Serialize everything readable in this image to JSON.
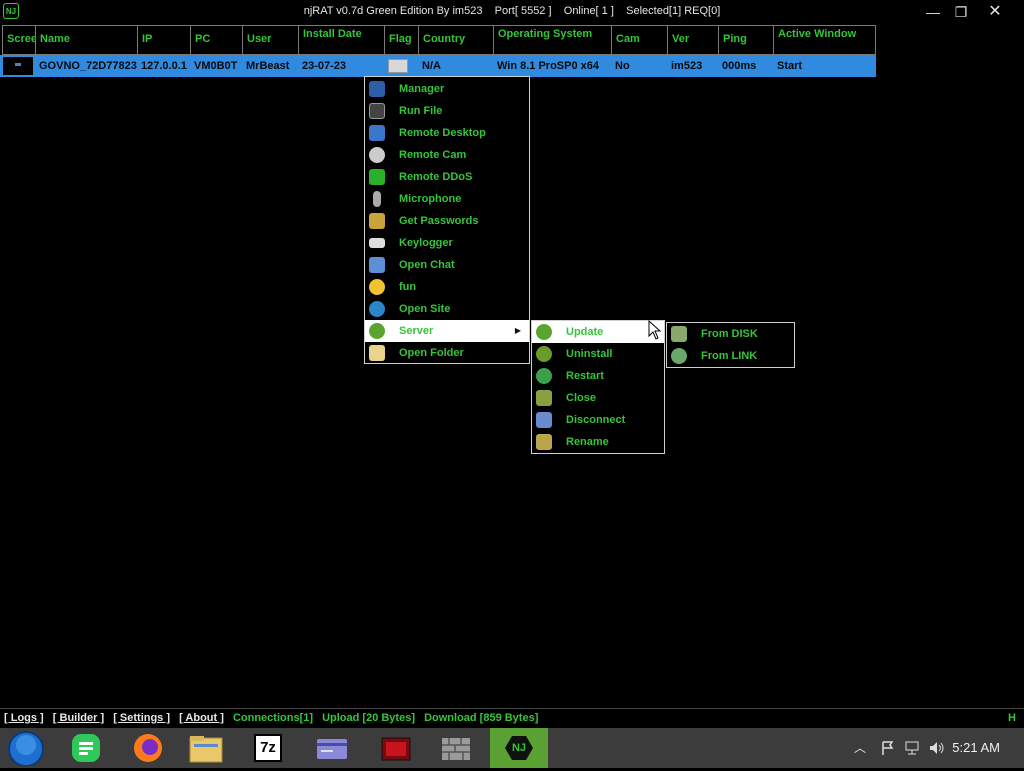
{
  "window": {
    "title": "njRAT v0.7d Green Edition By im523    Port[ 5552 ]    Online[ 1 ]    Selected[1] REQ[0]",
    "app_icon_text": "NJ",
    "minimize": "—",
    "maximize": "❐",
    "close": "✕"
  },
  "table": {
    "headers": [
      "Scree",
      "Name",
      "IP",
      "PC",
      "User",
      "Install Date",
      "Flag",
      "Country",
      "Operating System",
      "Cam",
      "Ver",
      "Ping",
      "Active Window"
    ],
    "row": {
      "name": "GOVNO_72D77823",
      "ip": "127.0.0.1",
      "pc": "VM0B0T",
      "user": "MrBeast",
      "install_date": "23-07-23",
      "country": "N/A",
      "os": "Win 8.1 ProSP0 x64",
      "cam": "No",
      "ver": "im523",
      "ping": "000ms",
      "active_window": "Start"
    }
  },
  "context_menu": {
    "items": [
      {
        "label": "Manager",
        "icon": "monitor-icon"
      },
      {
        "label": "Run File",
        "icon": "console-icon"
      },
      {
        "label": "Remote Desktop",
        "icon": "desktop-icon"
      },
      {
        "label": "Remote Cam",
        "icon": "webcam-icon"
      },
      {
        "label": "Remote DDoS",
        "icon": "ddos-icon"
      },
      {
        "label": "Microphone",
        "icon": "microphone-icon"
      },
      {
        "label": "Get Passwords",
        "icon": "key-icon"
      },
      {
        "label": "Keylogger",
        "icon": "keyboard-icon"
      },
      {
        "label": "Open Chat",
        "icon": "chat-icon"
      },
      {
        "label": "fun",
        "icon": "smiley-icon"
      },
      {
        "label": "Open Site",
        "icon": "globe-icon"
      },
      {
        "label": "Server",
        "icon": "gear-icon"
      },
      {
        "label": "Open Folder",
        "icon": "folder-icon"
      }
    ]
  },
  "server_submenu": {
    "items": [
      {
        "label": "Update",
        "icon": "update-icon"
      },
      {
        "label": "Uninstall",
        "icon": "uninstall-icon"
      },
      {
        "label": "Restart",
        "icon": "restart-icon"
      },
      {
        "label": "Close",
        "icon": "close-server-icon"
      },
      {
        "label": "Disconnect",
        "icon": "disconnect-icon"
      },
      {
        "label": "Rename",
        "icon": "rename-icon"
      }
    ]
  },
  "update_submenu": {
    "items": [
      {
        "label": "From DISK",
        "icon": "disk-icon"
      },
      {
        "label": "From LINK",
        "icon": "link-globe-icon"
      }
    ]
  },
  "statusbar": {
    "logs": "[ Logs ]",
    "builder": "[ Builder ]",
    "settings": "[ Settings ]",
    "about": "[ About ]",
    "connections": "Connections[1]",
    "upload": "Upload [20 Bytes]",
    "download": "Download [859 Bytes]",
    "right_mark": "H"
  },
  "taskbar": {
    "apps": [
      "start-orb-icon",
      "notes-app-icon",
      "firefox-icon",
      "file-explorer-icon",
      "7zip-icon",
      "card-app-icon",
      "media-app-icon",
      "firewall-icon",
      "njrat-icon"
    ],
    "njrat_label": "NJ",
    "sevenzip_label": "7z",
    "clock": "5:21 AM"
  },
  "colors": {
    "accent_green": "#35c43a",
    "selection_blue": "#2f8ae0",
    "background": "#000000",
    "taskbar": "#3c3c3c"
  }
}
